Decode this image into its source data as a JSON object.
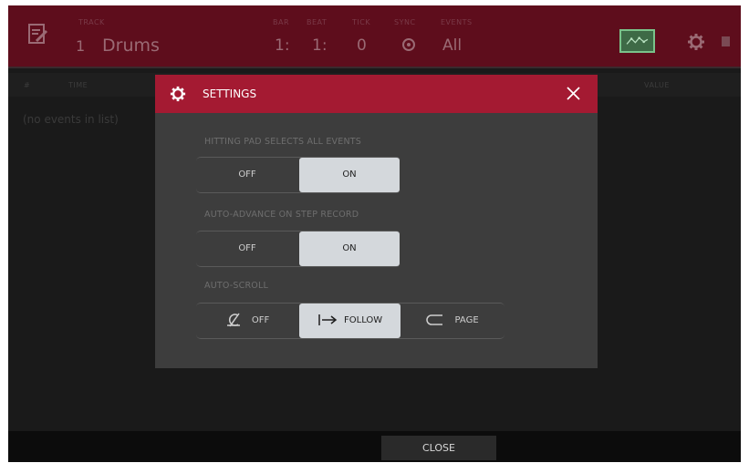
{
  "header": {
    "track_small_label": "TRACK",
    "track_number": "1",
    "track_name": "Drums",
    "bar_label": "BAR",
    "beat_label": "BEAT",
    "tick_label": "TICK",
    "sync_label": "SYNC",
    "events_label": "EVENTS",
    "bar_value": "1:",
    "beat_value": "1:",
    "tick_value": "0",
    "events_value": "All"
  },
  "table": {
    "columns": [
      "#",
      "TIME",
      "VALUE"
    ],
    "empty_text": "(no events in list)"
  },
  "modal": {
    "title": "SETTINGS",
    "settings": [
      {
        "label": "HITTING PAD SELECTS ALL EVENTS",
        "options": [
          "OFF",
          "ON"
        ],
        "selected": "ON"
      },
      {
        "label": "AUTO-ADVANCE ON STEP RECORD",
        "options": [
          "OFF",
          "ON"
        ],
        "selected": "ON"
      },
      {
        "label": "AUTO-SCROLL",
        "options": [
          "OFF",
          "FOLLOW",
          "PAGE"
        ],
        "selected": "FOLLOW"
      }
    ]
  },
  "footer": {
    "close_label": "CLOSE"
  },
  "colors": {
    "header_bg": "#5e0d1c",
    "modal_header": "#a41a32",
    "modal_bg": "#3d3d3d",
    "selected_option": "#d4d8dc",
    "accent_green": "#7ac28a"
  },
  "icons": [
    "edit-icon",
    "clock-icon",
    "waveform-icon",
    "gear-icon",
    "close-icon",
    "scroll-off-icon",
    "follow-arrow-icon",
    "page-icon"
  ]
}
